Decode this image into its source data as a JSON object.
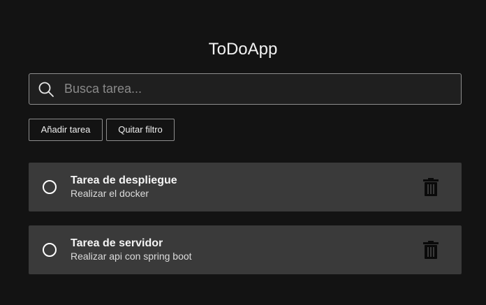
{
  "app": {
    "title": "ToDoApp"
  },
  "search": {
    "placeholder": "Busca tarea...",
    "value": "",
    "icon": "search-icon"
  },
  "toolbar": {
    "add_label": "Añadir tarea",
    "clear_filter_label": "Quitar filtro"
  },
  "tasks": [
    {
      "title": "Tarea de despliegue",
      "description": "Realizar el docker",
      "completed": false,
      "delete_icon": "trash-icon"
    },
    {
      "title": "Tarea de servidor",
      "description": "Realizar api con spring boot",
      "completed": false,
      "delete_icon": "trash-icon"
    }
  ],
  "colors": {
    "background": "#131313",
    "card": "#3a3a3a",
    "border": "#8e8e8e",
    "text": "#ffffff"
  }
}
